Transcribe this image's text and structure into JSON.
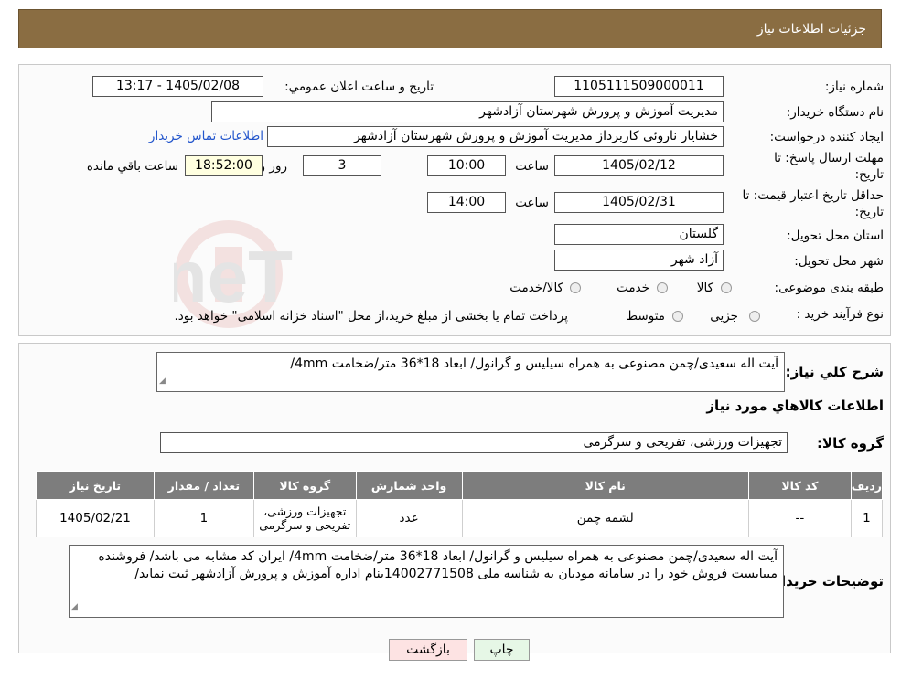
{
  "header": {
    "title": "جزئیات اطلاعات نیاز"
  },
  "form": {
    "need_number_label": "شماره نیاز:",
    "need_number": "1105111509000011",
    "announce_label": "تاریخ و ساعت اعلان عمومي:",
    "announce_value": "1405/02/08 - 13:17",
    "buyer_org_label": "نام دستگاه خریدار:",
    "buyer_org": "مدیریت آموزش و پرورش شهرستان آزادشهر",
    "requester_label": "ایجاد کننده درخواست:",
    "requester": "خشایار ناروئی کاربرداز مدیریت آموزش و پرورش شهرستان آزادشهر",
    "contact_link": "اطلاعات تماس خریدار",
    "deadline_label_1": "مهلت ارسال پاسخ: تا",
    "deadline_label_2": "تاریخ:",
    "deadline_date": "1405/02/12",
    "time_label": "ساعت",
    "deadline_time": "10:00",
    "days_value": "3",
    "days_label": "روز و",
    "remaining_time": "18:52:00",
    "remaining_label": "ساعت باقي مانده",
    "price_valid_label_1": "حداقل تاریخ اعتبار قیمت: تا",
    "price_valid_label_2": "تاریخ:",
    "price_valid_date": "1405/02/31",
    "price_valid_time": "14:00",
    "province_label": "استان محل تحویل:",
    "province": "گلستان",
    "city_label": "شهر محل تحویل:",
    "city": "آزاد شهر",
    "category_label": "طبقه بندی موضوعی:",
    "category_options": [
      "کالا",
      "خدمت",
      "کالا/خدمت"
    ],
    "process_label": "نوع فرآیند خرید :",
    "process_options": [
      "جزیی",
      "متوسط"
    ],
    "process_note": "پرداخت تمام یا بخشی از مبلغ خرید،از محل \"اسناد خزانه اسلامی\" خواهد بود."
  },
  "summary": {
    "desc_label": "شرح کلي نياز:",
    "desc": "آیت اله سعیدی/چمن مصنوعی به همراه سیلیس و گرانول/ ابعاد 18*36 متر/ضخامت 4mm/",
    "goods_info_title": "اطلاعات کالاهاي مورد نياز",
    "group_label": "گروه کالا:",
    "group_value": "تجهیزات ورزشی، تفریحی و سرگرمی"
  },
  "table": {
    "headers": [
      "رديف",
      "کد کالا",
      "نام کالا",
      "واحد شمارش",
      "گروه کالا",
      "تعداد / مقدار",
      "تاریخ نیاز"
    ],
    "rows": [
      [
        "1",
        "--",
        "لشمه چمن",
        "عدد",
        "تجهیزات ورزشی، تفریحی و سرگرمی",
        "1",
        "1405/02/21"
      ]
    ]
  },
  "buyer_notes": {
    "label": "توضیحات خریدار:",
    "text": "آیت اله سعیدی/چمن مصنوعی به همراه سیلیس و گرانول/ ابعاد 18*36 متر/ضخامت 4mm/ ایران کد مشابه می باشد/ فروشنده میبایست فروش خود را در سامانه مودیان به شناسه ملی 14002771508بنام اداره آموزش و پرورش آزادشهر ثبت نماید/"
  },
  "buttons": {
    "print": "چاپ",
    "back": "بازگشت"
  },
  "watermark": {
    "text": "AriaTender.neT"
  },
  "colors": {
    "header_bg": "#8a6d42",
    "table_header_bg": "#7d7d7d",
    "remaining_bg": "#ffffe0",
    "link": "#2255cc"
  }
}
